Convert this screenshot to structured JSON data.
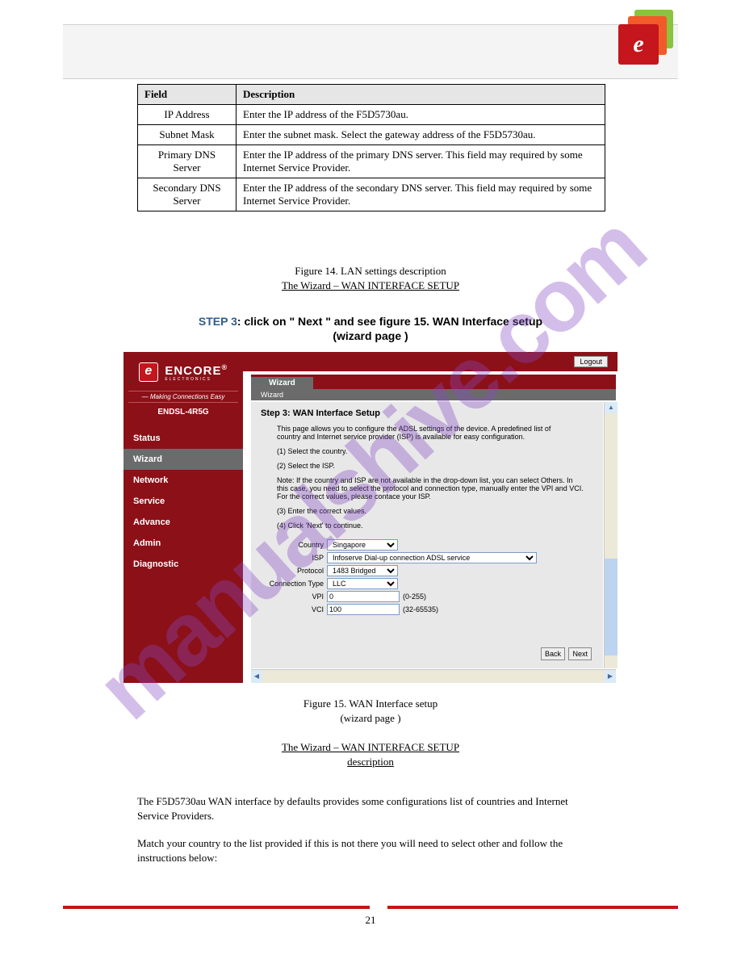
{
  "table": {
    "header_field": "Field",
    "header_desc": "Description",
    "rows": [
      {
        "field": "IP Address",
        "desc": "Enter the IP address of the F5D5730au."
      },
      {
        "field": "Subnet Mask",
        "desc": "Enter the subnet mask. Select the gateway address of the F5D5730au."
      },
      {
        "field": "Primary DNS Server",
        "desc": "Enter the IP address of the primary DNS server. This field may required by some Internet Service Provider."
      },
      {
        "field": "Secondary DNS Server",
        "desc": "Enter the IP address of the secondary DNS server. This field may required by some Internet Service Provider."
      }
    ]
  },
  "captions": {
    "c1": "Figure 14. LAN settings description",
    "c2a": "The Wizard – WAN INTERFACE SETUP",
    "step1_a": "STEP 3",
    "step1_b": ": click on \" Next \" and see figure 15. WAN Interface setup",
    "step2a": "(wizard page )",
    "c3": "Figure 15.  WAN Interface setup",
    "c3b": "(wizard page )",
    "c4a": "The Wizard – WAN INTERFACE SETUP",
    "c4b": "description",
    "para1": "The F5D5730au WAN interface by defaults provides some configurations list of countries and Internet Service Providers.",
    "para2": "Match your country to the list provided if this is not there you will need to select other and follow the instructions below:"
  },
  "router": {
    "brand_name": "ENCORE",
    "brand_sub": "ELECTRONICS",
    "tagline": "— Making Connections Easy",
    "model": "ENDSL-4R5G",
    "logout": "Logout",
    "tab": "Wizard",
    "subtab": "Wizard",
    "side_items": [
      {
        "label": "Status",
        "active": false
      },
      {
        "label": "Wizard",
        "active": true
      },
      {
        "label": "Network",
        "active": false
      },
      {
        "label": "Service",
        "active": false
      },
      {
        "label": "Advance",
        "active": false
      },
      {
        "label": "Admin",
        "active": false
      },
      {
        "label": "Diagnostic",
        "active": false
      }
    ],
    "content": {
      "heading": "Step 3: WAN Interface Setup",
      "intro": "This page allows you to configure the ADSL settings of the device. A predefined list of country and Internet service provider (ISP) is available for easy configuration.",
      "li1": "(1) Select the country.",
      "li2": "(2) Select the ISP.",
      "note": "Note: If the country and ISP are not available in the drop-down list, you can select Others. In this case, you need to select the protocol and connection type, manually enter the VPI and VCI. For the correct values, please contace your ISP.",
      "li3": "(3) Enter the correct values.",
      "li4": "(4) Click 'Next' to continue.",
      "labels": {
        "country": "Country",
        "isp": "ISP",
        "protocol": "Protocol",
        "conn": "Connection Type",
        "vpi": "VPI",
        "vci": "VCI"
      },
      "values": {
        "country": "Singapore",
        "isp": "Infoserve Dial-up connection ADSL service",
        "protocol": "1483 Bridged",
        "conn": "LLC",
        "vpi": "0",
        "vci": "100"
      },
      "hints": {
        "vpi": "(0-255)",
        "vci": "(32-65535)"
      },
      "back": "Back",
      "next": "Next"
    }
  },
  "watermark": "manualshive.com",
  "page_number": "21"
}
